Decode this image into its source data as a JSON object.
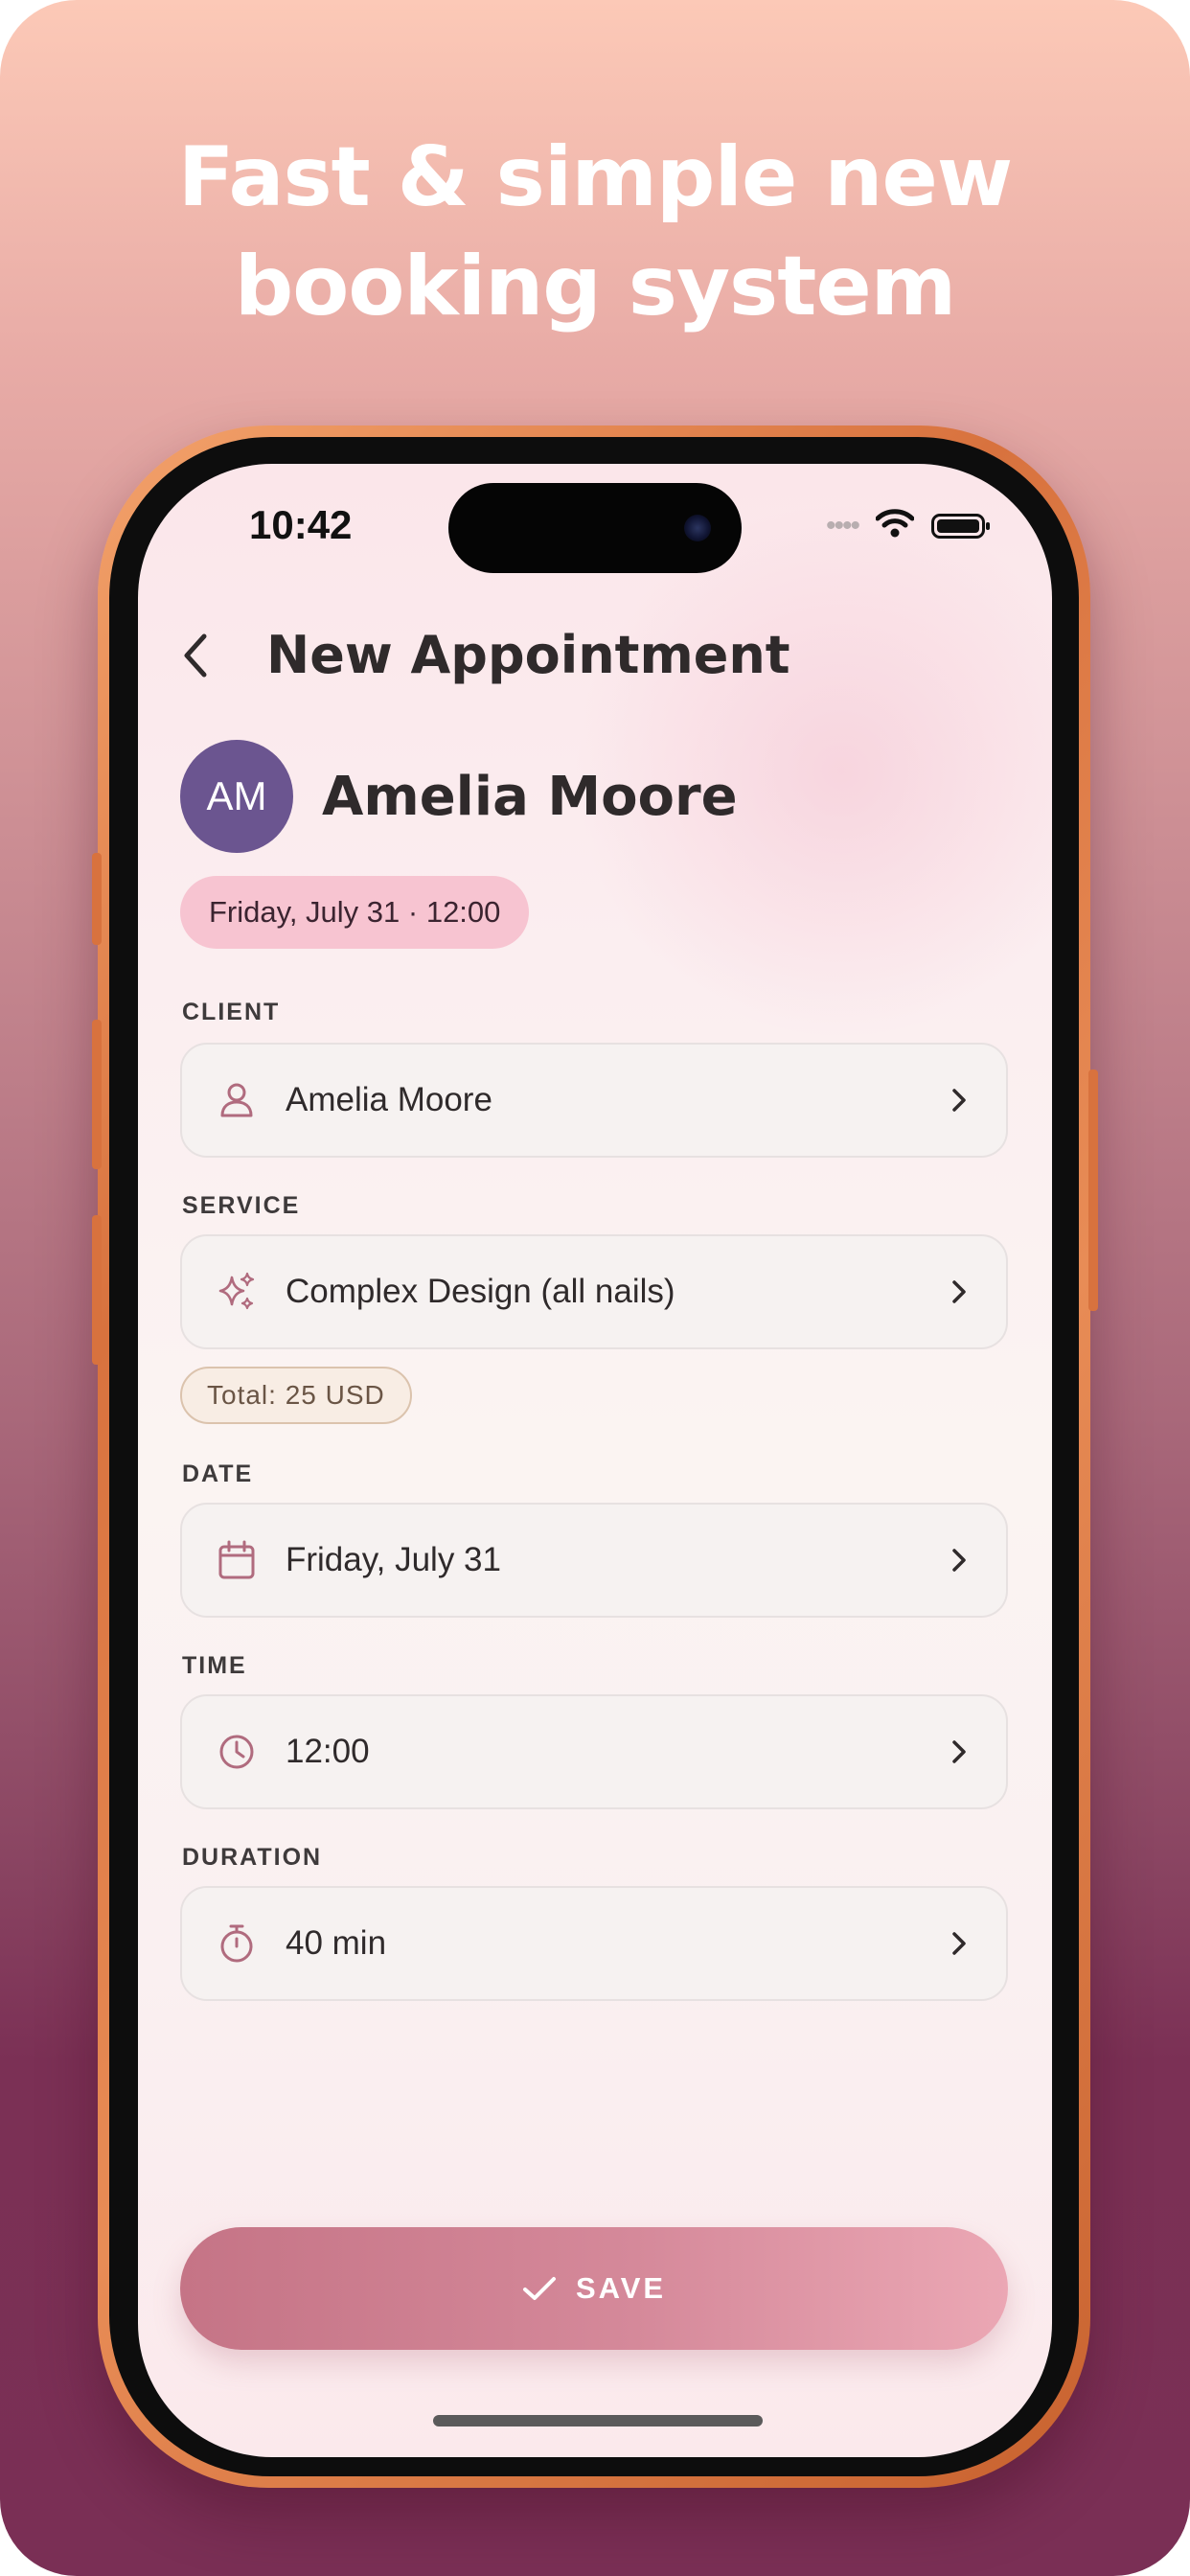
{
  "headline": {
    "line1": "Fast & simple new",
    "line2": "booking system"
  },
  "status_bar": {
    "time": "10:42",
    "icons": [
      "signal-dots-icon",
      "wifi-icon",
      "battery-icon"
    ]
  },
  "nav": {
    "back_icon": "chevron-left-icon",
    "title": "New Appointment"
  },
  "appointment": {
    "avatar_initials": "AM",
    "client_name": "Amelia Moore",
    "datetime_pill": "Friday, July 31 · 12:00"
  },
  "form": {
    "client": {
      "label": "CLIENT",
      "value": "Amelia Moore",
      "icon": "person-icon"
    },
    "service": {
      "label": "SERVICE",
      "value": "Complex Design (all nails)",
      "icon": "sparkles-icon"
    },
    "total": "Total: 25 USD",
    "date": {
      "label": "DATE",
      "value": "Friday, July 31",
      "icon": "calendar-icon"
    },
    "time": {
      "label": "TIME",
      "value": "12:00",
      "icon": "clock-icon"
    },
    "duration": {
      "label": "DURATION",
      "value": "40 min",
      "icon": "stopwatch-icon"
    }
  },
  "save_button": {
    "label": "SAVE",
    "icon": "check-icon"
  },
  "colors": {
    "accent": "#c57486",
    "avatar": "#6b5590",
    "pill": "#f7c4d1",
    "icon": "#b06b7e",
    "frame": "#d8723e"
  }
}
